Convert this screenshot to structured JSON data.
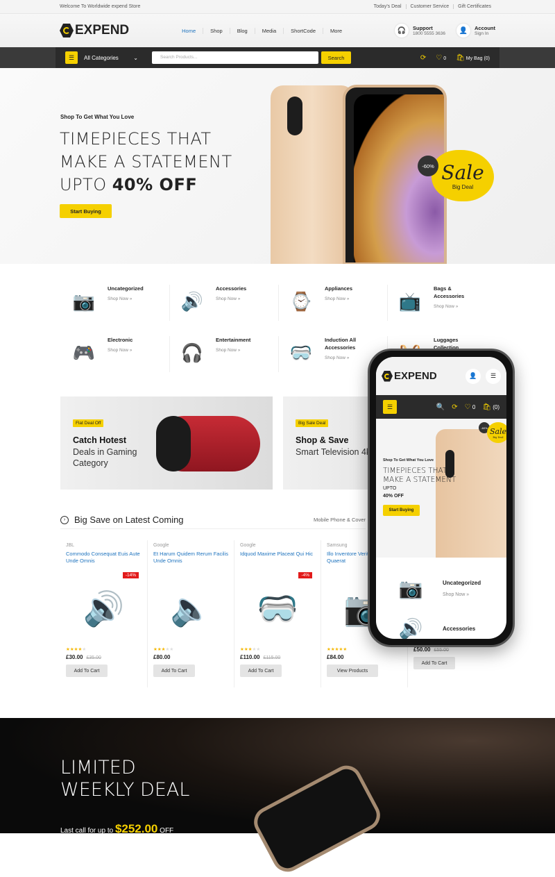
{
  "topbar": {
    "welcome": "Welcome To Worldwide expend Store",
    "links": [
      "Today's Deal",
      "Customer Service",
      "Gift Certificates"
    ]
  },
  "header": {
    "logo": "EXPEND",
    "nav": [
      "Home",
      "Shop",
      "Blog",
      "Media",
      "ShortCode",
      "More"
    ],
    "support": {
      "label": "Support",
      "phone": "1800 5555 3636"
    },
    "account": {
      "label": "Account",
      "sub": "Sign In"
    }
  },
  "searchbar": {
    "categories": "All Categories",
    "placeholder": "Search Products...",
    "search_label": "Search",
    "wishlist_count": "0",
    "bag": "My Bag (0)"
  },
  "hero": {
    "subtitle": "Shop To Get What You Love",
    "line1": "TIMEPIECES THAT",
    "line2": "MAKE A STATEMENT",
    "line3": "UPTO",
    "highlight": "40% OFF",
    "button": "Start Buying",
    "sale_text": "Sale",
    "sale_sub": "Big Deal",
    "discount": "-60%"
  },
  "categories": [
    {
      "name": "Uncategorized",
      "link": "Shop Now »",
      "icon": "📷"
    },
    {
      "name": "Accessories",
      "link": "Shop Now »",
      "icon": "🔊"
    },
    {
      "name": "Appliances",
      "link": "Shop Now »",
      "icon": "⌚"
    },
    {
      "name": "Bags & Accessories",
      "link": "Shop Now »",
      "icon": "📺"
    },
    {
      "name": "Electronic",
      "link": "Shop Now »",
      "icon": "🎮"
    },
    {
      "name": "Entertainment",
      "link": "Shop Now »",
      "icon": "🎧"
    },
    {
      "name": "Induction All Accessories",
      "link": "Shop Now »",
      "icon": "🥽"
    },
    {
      "name": "Luggages Collection",
      "link": "Shop Now »",
      "icon": "🧺"
    }
  ],
  "banners": [
    {
      "tag": "Flat Deal Off",
      "title": "Catch Hotest",
      "text": "Deals in Gaming Category"
    },
    {
      "tag": "Big Sale Deal",
      "title": "Shop & Save",
      "text": "Smart Television 4k HD"
    }
  ],
  "section": {
    "title": "Big Save on Latest Coming",
    "filter": "Mobile Phone & Cover"
  },
  "products": [
    {
      "brand": "JBL",
      "name": "Commodo Consequat Euis Aute Unde Omnis",
      "discount": "-14%",
      "rating": 4,
      "price": "£30.00",
      "old_price": "£35.00",
      "button": "Add To Cart",
      "icon": "🔊"
    },
    {
      "brand": "Google",
      "name": "Et Harum Quidem Rerum Facilis Unde Omnis",
      "discount": "",
      "rating": 3,
      "price": "£80.00",
      "old_price": "",
      "button": "Add To Cart",
      "icon": "🔈"
    },
    {
      "brand": "Google",
      "name": "Idquod Maxime Placeat Qui Hic",
      "discount": "-4%",
      "rating": 3,
      "price": "£110.00",
      "old_price": "£115.00",
      "button": "Add To Cart",
      "icon": "🥽"
    },
    {
      "brand": "Samsung",
      "name": "Illo Inventore Veritatis Aliquam Quaerat",
      "discount": "",
      "rating": 5,
      "price": "£84.00",
      "old_price": "",
      "button": "View Products",
      "icon": "📷"
    },
    {
      "brand": "",
      "name": "",
      "discount": "",
      "rating": 0,
      "price": "£50.00",
      "old_price": "£55.00",
      "button": "Add To Cart",
      "icon": ""
    }
  ],
  "deal": {
    "line1": "LIMITED",
    "line2": "WEEKLY DEAL",
    "prefix": "Last call for up to",
    "amount": "$252.00",
    "suffix": "OFF"
  },
  "mobile": {
    "logo": "EXPEND",
    "wishlist_count": "0",
    "bag": "(0)",
    "hero_sub": "Shop To Get What You Love",
    "hero_line1": "TIMEPIECES THAT",
    "hero_line2": "MAKE A STATEMENT",
    "hero_upto": "UPTO",
    "hero_off": "40% OFF",
    "hero_button": "Start Buying",
    "sale": "Sale",
    "sale_sub": "Big Deal",
    "discount": "-60%",
    "cat1": "Uncategorized",
    "cat1_link": "Shop Now »",
    "cat2": "Accessories"
  }
}
